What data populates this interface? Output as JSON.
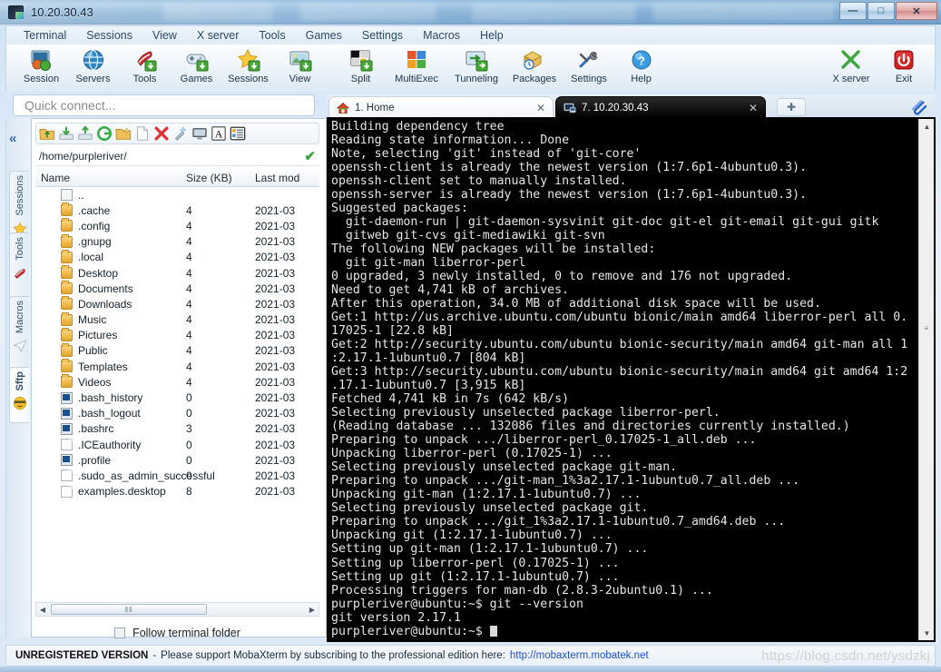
{
  "window": {
    "title": "10.20.30.43",
    "icon": "mobaxterm-icon",
    "minimize_label": "—",
    "maximize_label": "□",
    "close_label": "✕"
  },
  "menubar": {
    "items": [
      {
        "label": "Terminal",
        "name": "menu-terminal"
      },
      {
        "label": "Sessions",
        "name": "menu-sessions"
      },
      {
        "label": "View",
        "name": "menu-view"
      },
      {
        "label": "X server",
        "name": "menu-xserver"
      },
      {
        "label": "Tools",
        "name": "menu-tools"
      },
      {
        "label": "Games",
        "name": "menu-games"
      },
      {
        "label": "Settings",
        "name": "menu-settings"
      },
      {
        "label": "Macros",
        "name": "menu-macros"
      },
      {
        "label": "Help",
        "name": "menu-help"
      }
    ]
  },
  "toolbar": {
    "buttons": [
      {
        "label": "Session",
        "icon": "session-icon"
      },
      {
        "label": "Servers",
        "icon": "servers-icon"
      },
      {
        "label": "Tools",
        "icon": "tools-icon"
      },
      {
        "label": "Games",
        "icon": "games-icon"
      },
      {
        "label": "Sessions",
        "icon": "sessions-star-icon"
      },
      {
        "label": "View",
        "icon": "view-icon"
      },
      {
        "label": "Split",
        "icon": "split-icon"
      },
      {
        "label": "MultiExec",
        "icon": "multiexec-icon"
      },
      {
        "label": "Tunneling",
        "icon": "tunneling-icon"
      },
      {
        "label": "Packages",
        "icon": "packages-icon"
      },
      {
        "label": "Settings",
        "icon": "settings-icon"
      },
      {
        "label": "Help",
        "icon": "help-icon"
      }
    ],
    "right_buttons": [
      {
        "label": "X server",
        "icon": "xserver-icon"
      },
      {
        "label": "Exit",
        "icon": "exit-power-icon"
      }
    ]
  },
  "quick_connect": {
    "placeholder": "Quick connect...",
    "value": ""
  },
  "rail": {
    "collapse_label": "«",
    "tabs": [
      {
        "label": "Sessions",
        "icon": "star-icon",
        "active": false
      },
      {
        "label": "Tools",
        "icon": "swiss-knife-icon",
        "active": false
      },
      {
        "label": "Macros",
        "icon": "paper-plane-icon",
        "active": false
      },
      {
        "label": "Sftp",
        "icon": "smiley-icon",
        "active": true
      }
    ]
  },
  "file_browser": {
    "toolbar_icons": [
      "upload-folder-icon",
      "download-icon",
      "upload-icon",
      "refresh-icon",
      "new-folder-icon",
      "new-file-icon",
      "delete-icon",
      "permissions-icon",
      "open-terminal-icon",
      "text-mode-icon",
      "details-view-icon"
    ],
    "path": "/home/purpleriver/",
    "path_ok_icon": "green-check-icon",
    "columns": [
      "Name",
      "Size (KB)",
      "Last mod"
    ],
    "rows": [
      {
        "name": "..",
        "size": "",
        "date": "",
        "icon": "parent-dir-icon"
      },
      {
        "name": ".cache",
        "size": "4",
        "date": "2021-03",
        "icon": "folder-icon"
      },
      {
        "name": ".config",
        "size": "4",
        "date": "2021-03",
        "icon": "folder-icon"
      },
      {
        "name": ".gnupg",
        "size": "4",
        "date": "2021-03",
        "icon": "folder-icon"
      },
      {
        "name": ".local",
        "size": "4",
        "date": "2021-03",
        "icon": "folder-icon"
      },
      {
        "name": "Desktop",
        "size": "4",
        "date": "2021-03",
        "icon": "folder-icon"
      },
      {
        "name": "Documents",
        "size": "4",
        "date": "2021-03",
        "icon": "folder-icon"
      },
      {
        "name": "Downloads",
        "size": "4",
        "date": "2021-03",
        "icon": "folder-icon"
      },
      {
        "name": "Music",
        "size": "4",
        "date": "2021-03",
        "icon": "folder-icon"
      },
      {
        "name": "Pictures",
        "size": "4",
        "date": "2021-03",
        "icon": "folder-icon"
      },
      {
        "name": "Public",
        "size": "4",
        "date": "2021-03",
        "icon": "folder-icon"
      },
      {
        "name": "Templates",
        "size": "4",
        "date": "2021-03",
        "icon": "folder-icon"
      },
      {
        "name": "Videos",
        "size": "4",
        "date": "2021-03",
        "icon": "folder-icon"
      },
      {
        "name": ".bash_history",
        "size": "0",
        "date": "2021-03",
        "icon": "script-icon"
      },
      {
        "name": ".bash_logout",
        "size": "0",
        "date": "2021-03",
        "icon": "script-icon"
      },
      {
        "name": ".bashrc",
        "size": "3",
        "date": "2021-03",
        "icon": "script-icon"
      },
      {
        "name": ".ICEauthority",
        "size": "0",
        "date": "2021-03",
        "icon": "file-icon"
      },
      {
        "name": ".profile",
        "size": "0",
        "date": "2021-03",
        "icon": "script-icon"
      },
      {
        "name": ".sudo_as_admin_successful",
        "size": "0",
        "date": "2021-03",
        "icon": "file-icon"
      },
      {
        "name": "examples.desktop",
        "size": "8",
        "date": "2021-03",
        "icon": "file-icon"
      }
    ],
    "hscroll": {
      "left_arrow": "◀",
      "right_arrow": "▶",
      "grip": "‖‖"
    },
    "follow_terminal_folder": {
      "label": "Follow terminal folder",
      "checked": false
    }
  },
  "tabs": {
    "items": [
      {
        "label": "1. Home",
        "icon": "home-icon",
        "active": false,
        "close": "✕"
      },
      {
        "label": "7. 10.20.30.43",
        "icon": "server-icon",
        "active": true,
        "close": "✕"
      }
    ],
    "add_label": "✚",
    "clip_icon": "paperclip-icon"
  },
  "terminal": {
    "lines": [
      "Building dependency tree",
      "Reading state information... Done",
      "Note, selecting 'git' instead of 'git-core'",
      "openssh-client is already the newest version (1:7.6p1-4ubuntu0.3).",
      "openssh-client set to manually installed.",
      "openssh-server is already the newest version (1:7.6p1-4ubuntu0.3).",
      "Suggested packages:",
      "  git-daemon-run | git-daemon-sysvinit git-doc git-el git-email git-gui gitk",
      "  gitweb git-cvs git-mediawiki git-svn",
      "The following NEW packages will be installed:",
      "  git git-man liberror-perl",
      "0 upgraded, 3 newly installed, 0 to remove and 176 not upgraded.",
      "Need to get 4,741 kB of archives.",
      "After this operation, 34.0 MB of additional disk space will be used.",
      "Get:1 http://us.archive.ubuntu.com/ubuntu bionic/main amd64 liberror-perl all 0.",
      "17025-1 [22.8 kB]",
      "Get:2 http://security.ubuntu.com/ubuntu bionic-security/main amd64 git-man all 1",
      ":2.17.1-1ubuntu0.7 [804 kB]",
      "Get:3 http://security.ubuntu.com/ubuntu bionic-security/main amd64 git amd64 1:2",
      ".17.1-1ubuntu0.7 [3,915 kB]",
      "Fetched 4,741 kB in 7s (642 kB/s)",
      "Selecting previously unselected package liberror-perl.",
      "(Reading database ... 132086 files and directories currently installed.)",
      "Preparing to unpack .../liberror-perl_0.17025-1_all.deb ...",
      "Unpacking liberror-perl (0.17025-1) ...",
      "Selecting previously unselected package git-man.",
      "Preparing to unpack .../git-man_1%3a2.17.1-1ubuntu0.7_all.deb ...",
      "Unpacking git-man (1:2.17.1-1ubuntu0.7) ...",
      "Selecting previously unselected package git.",
      "Preparing to unpack .../git_1%3a2.17.1-1ubuntu0.7_amd64.deb ...",
      "Unpacking git (1:2.17.1-1ubuntu0.7) ...",
      "Setting up git-man (1:2.17.1-1ubuntu0.7) ...",
      "Setting up liberror-perl (0.17025-1) ...",
      "Setting up git (1:2.17.1-1ubuntu0.7) ...",
      "Processing triggers for man-db (2.8.3-2ubuntu0.1) ...",
      "purpleriver@ubuntu:~$ git --version",
      "git version 2.17.1"
    ],
    "prompt": "purpleriver@ubuntu:~$ ",
    "scroll_up_arrow": "▲",
    "scroll_down_arrow": "▼"
  },
  "statusbar": {
    "strong": "UNREGISTERED VERSION",
    "dash": "-",
    "message": "Please support MobaXterm by subscribing to the professional edition here:",
    "link": "http://mobaxterm.mobatek.net"
  },
  "watermark": "https://blog.csdn.net/ysdzkj",
  "colors": {
    "accent": "#2f6fae",
    "terminal_bg": "#000000",
    "terminal_fg": "#e6e6e6",
    "link": "#1b4fd0",
    "ok_green": "#3aa33a"
  }
}
